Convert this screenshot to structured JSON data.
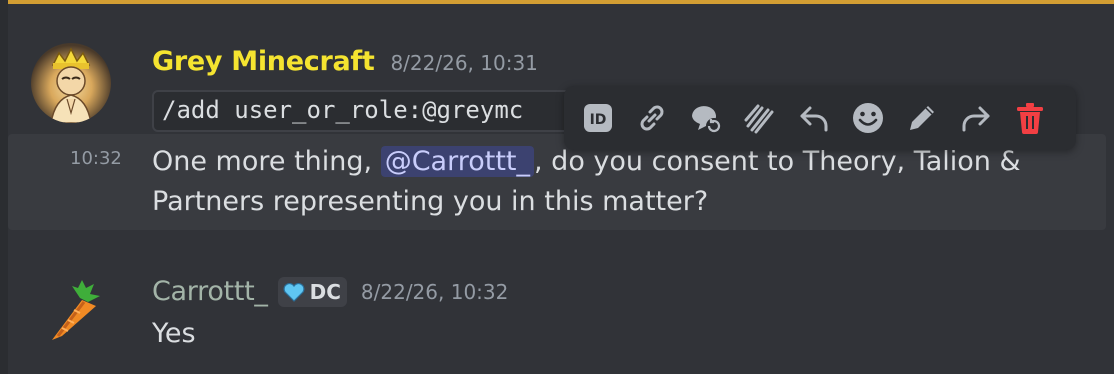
{
  "messages": [
    {
      "author": "Grey Minecraft",
      "author_color": "#f5e430",
      "timestamp": "8/22/26, 10:31",
      "command_text": "/add user_or_role:@greymc"
    },
    {
      "timestamp": "10:32",
      "text_before": "One more thing, ",
      "mention": "@Carrottt_",
      "text_after": ", do you consent to Theory, Talion & Partners representing you in this matter?"
    },
    {
      "author": "Carrottt_",
      "author_color": "#a3b4a8",
      "badge_text": "DC",
      "timestamp": "8/22/26, 10:32",
      "text": "Yes"
    }
  ],
  "toolbar": {
    "icons": [
      "id-icon",
      "link-icon",
      "thread-icon",
      "apps-icon",
      "reply-icon",
      "emoji-icon",
      "edit-icon",
      "forward-icon",
      "delete-icon"
    ]
  },
  "colors": {
    "background": "#313338",
    "hover": "#393b40",
    "toolbar": "#2b2d31",
    "mention_bg": "#3c4270",
    "delete": "#f23f43"
  }
}
